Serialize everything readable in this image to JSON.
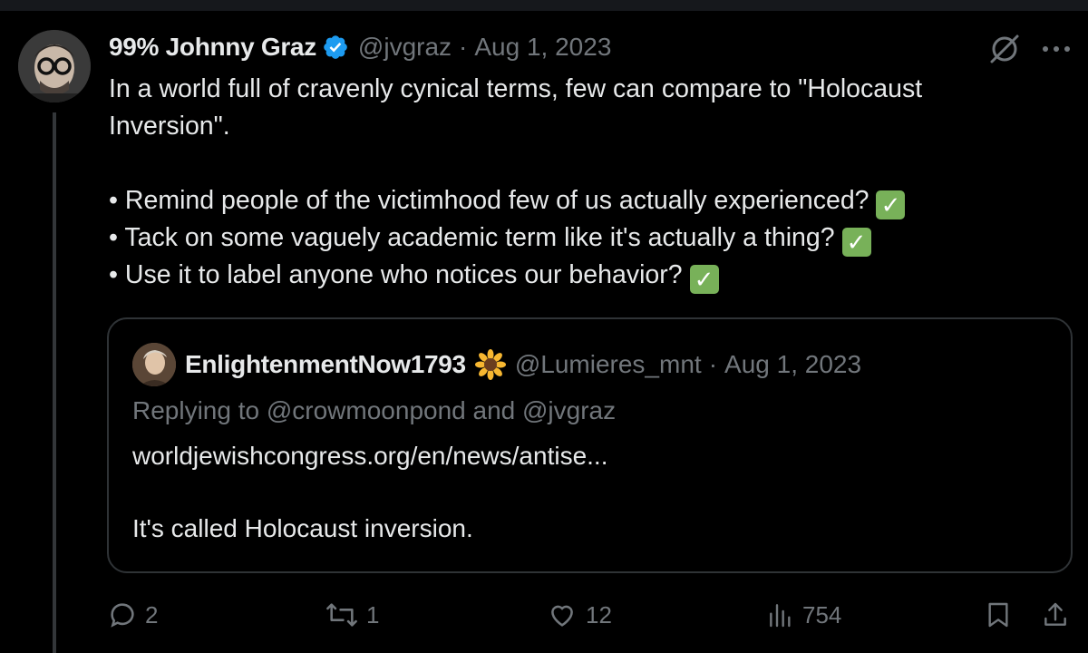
{
  "tweet": {
    "author_name": "99% Johnny Graz",
    "handle": "@jvgraz",
    "separator": "·",
    "date": "Aug 1, 2023",
    "verified": true,
    "lines": [
      "In a world full of cravenly cynical terms, few can compare to \"Holocaust",
      "Inversion\".",
      "• Remind people of the victimhood few of us actually experienced?",
      "• Tack on some vaguely academic term like it's actually a thing?",
      "• Use it to label anyone who notices our behavior?"
    ],
    "check_emoji": "✓"
  },
  "quote": {
    "author_name": "EnlightenmentNow1793",
    "handle": "@Lumieres_mnt",
    "separator": "·",
    "date": "Aug 1, 2023",
    "replying_to": "Replying to @crowmoonpond and @jvgraz",
    "link": "worldjewishcongress.org/en/news/antise...",
    "text": "It's called Holocaust inversion."
  },
  "actions": {
    "replies": "2",
    "reposts": "1",
    "likes": "12",
    "views": "754"
  },
  "colors": {
    "background": "#000000",
    "primary_text": "#e7e9ea",
    "secondary_text": "#71767b",
    "border": "#2f3336",
    "verified_blue": "#1d9bf0",
    "check_green": "#78b159"
  },
  "icons": [
    "verified-badge-icon",
    "grok-icon",
    "more-icon",
    "sunflower-icon",
    "reply-icon",
    "repost-icon",
    "like-icon",
    "views-icon",
    "bookmark-icon",
    "share-icon"
  ]
}
